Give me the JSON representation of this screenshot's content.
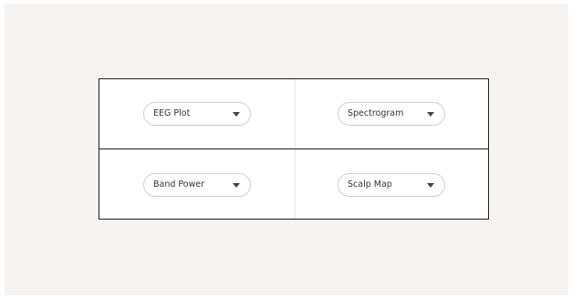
{
  "panels": [
    {
      "select_value": "EEG Plot",
      "icon": "triangle-down"
    },
    {
      "select_value": "Spectrogram",
      "icon": "triangle-down"
    },
    {
      "select_value": "Band Power",
      "icon": "triangle-down"
    },
    {
      "select_value": "Scalp Map",
      "icon": "triangle-down"
    }
  ],
  "colors": {
    "page_background": "#f6f3f0",
    "grid_border": "#1e1e1e",
    "select_border": "#d0d0d0"
  }
}
